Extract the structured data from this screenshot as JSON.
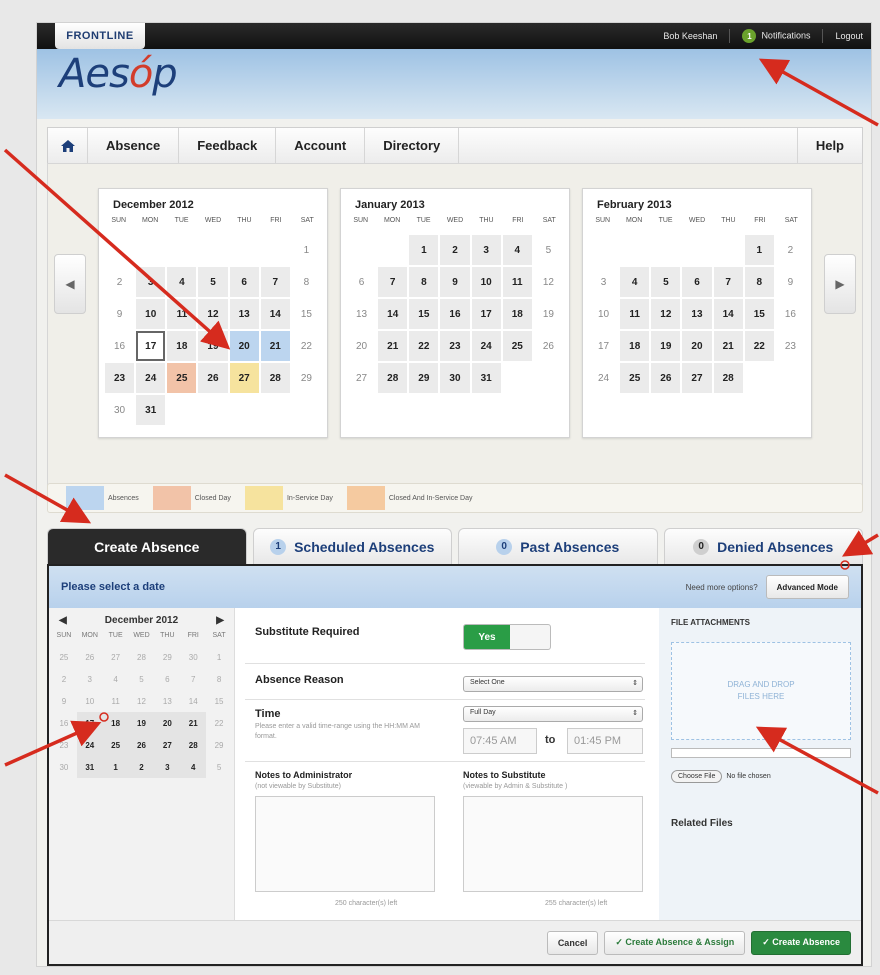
{
  "topbar": {
    "brand": "FRONTLINE",
    "user": "Bob Keeshan",
    "notif_count": "1",
    "notifications": "Notifications",
    "logout": "Logout"
  },
  "header": {
    "logo_pre": "Aes",
    "logo_leaf": "ó",
    "logo_post": "p"
  },
  "nav": {
    "items": [
      "Absence",
      "Feedback",
      "Account",
      "Directory"
    ],
    "help": "Help"
  },
  "calendars": [
    {
      "title": "December 2012"
    },
    {
      "title": "January 2013"
    },
    {
      "title": "February 2013"
    }
  ],
  "dow": [
    "SUN",
    "MON",
    "TUE",
    "WED",
    "THU",
    "FRI",
    "SAT"
  ],
  "legend": [
    "Absences",
    "Closed Day",
    "In-Service Day",
    "Closed And In-Service Day"
  ],
  "legend_colors": {
    "absences": "#bcd5ef",
    "closed": "#f2c3a8",
    "inservice": "#f6e39e",
    "both": "#f5caa0"
  },
  "tabs": [
    {
      "label": "Create Absence"
    },
    {
      "count": "1",
      "label": "Scheduled Absences"
    },
    {
      "count": "0",
      "label": "Past Absences"
    },
    {
      "count": "0",
      "label": "Denied Absences"
    }
  ],
  "form": {
    "prompt": "Please select a date",
    "need_more": "Need more options?",
    "advanced": "Advanced Mode",
    "mini_title": "December 2012",
    "substitute_required": "Substitute Required",
    "yes": "Yes",
    "absence_reason": "Absence Reason",
    "reason_value": "Select One",
    "time": "Time",
    "time_help": "Please enter a valid time-range using the HH:MM AM format.",
    "time_value": "Full Day",
    "start": "07:45 AM",
    "to": "to",
    "end": "01:45 PM",
    "notes_admin": "Notes to Administrator",
    "notes_admin_sub": "(not viewable by Substitute)",
    "notes_sub": "Notes to Substitute",
    "notes_sub_sub": "(viewable by Admin & Substitute )",
    "count_admin": "250 character(s) left",
    "count_sub": "255 character(s) left",
    "file_attachments": "FILE ATTACHMENTS",
    "drag_drop": "DRAG AND DROP",
    "files_here": "FILES HERE",
    "choose_file": "Choose File",
    "no_file": "No file chosen",
    "related": "Related Files",
    "cancel": "Cancel",
    "create_assign": "✓ Create Absence & Assign",
    "create": "✓ Create Absence"
  }
}
